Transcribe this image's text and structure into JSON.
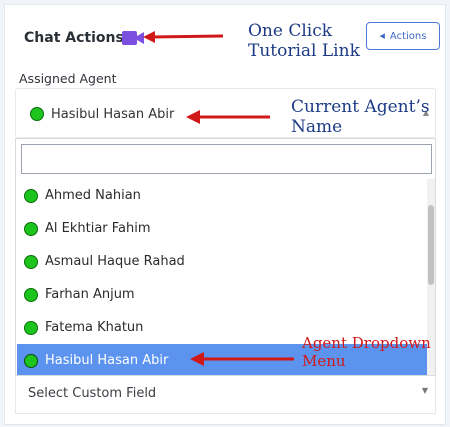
{
  "header": {
    "title": "Chat Actions",
    "actions_label": "Actions"
  },
  "assigned_agent": {
    "label": "Assigned Agent",
    "selected": "Hasibul Hasan Abir"
  },
  "dropdown": {
    "search_value": "",
    "options": [
      {
        "name": "Ahmed Nahian",
        "active": false
      },
      {
        "name": "Al Ekhtiar Fahim",
        "active": false
      },
      {
        "name": "Asmaul Haque Rahad",
        "active": false
      },
      {
        "name": "Farhan Anjum",
        "active": false
      },
      {
        "name": "Fatema Khatun",
        "active": false
      },
      {
        "name": "Hasibul Hasan Abir",
        "active": true
      }
    ]
  },
  "custom_field": {
    "placeholder": "Select Custom Field"
  },
  "annotations": {
    "tutorial_line1": "One Click",
    "tutorial_line2": "Tutorial Link",
    "current_line1": "Current Agent’s",
    "current_line2": "Name",
    "dropdown_line1": "Agent Dropdown",
    "dropdown_line2": "Menu"
  },
  "colors": {
    "online_dot": "#1ec41e",
    "accent": "#4e7ad4",
    "selected_option_bg": "#5b93ef",
    "video_icon": "#7b4fe0",
    "annotation_arrow": "#d11818"
  },
  "icons": {
    "video": "video-camera-icon",
    "chevron_left": "chevron-left-icon",
    "caret_up": "caret-up-icon",
    "caret_down": "caret-down-icon",
    "status": "online-status-icon"
  }
}
